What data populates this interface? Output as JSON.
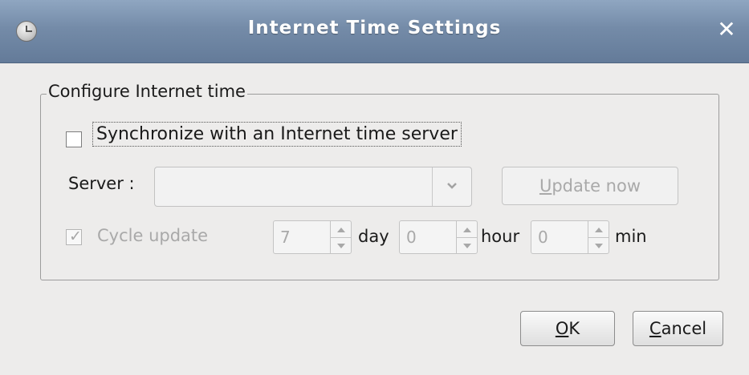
{
  "window": {
    "title": "Internet Time Settings",
    "close_glyph": "✕",
    "icon": "clock-icon"
  },
  "group": {
    "legend": "Configure Internet time"
  },
  "sync": {
    "label": "Synchronize with an Internet time server",
    "checked": false
  },
  "server": {
    "label": "Server :",
    "value": "",
    "update_button": "Update now",
    "update_disabled": true
  },
  "cycle": {
    "label": "Cycle update",
    "checked": true,
    "disabled": true,
    "day_value": "7",
    "day_unit": "day",
    "hour_value": "0",
    "hour_unit": "hour",
    "min_value": "0",
    "min_unit": "min"
  },
  "buttons": {
    "ok": "OK",
    "cancel": "Cancel"
  },
  "colors": {
    "titlebar": "#748ba8",
    "background": "#edeceb",
    "disabled_text": "#a9a9a9"
  }
}
